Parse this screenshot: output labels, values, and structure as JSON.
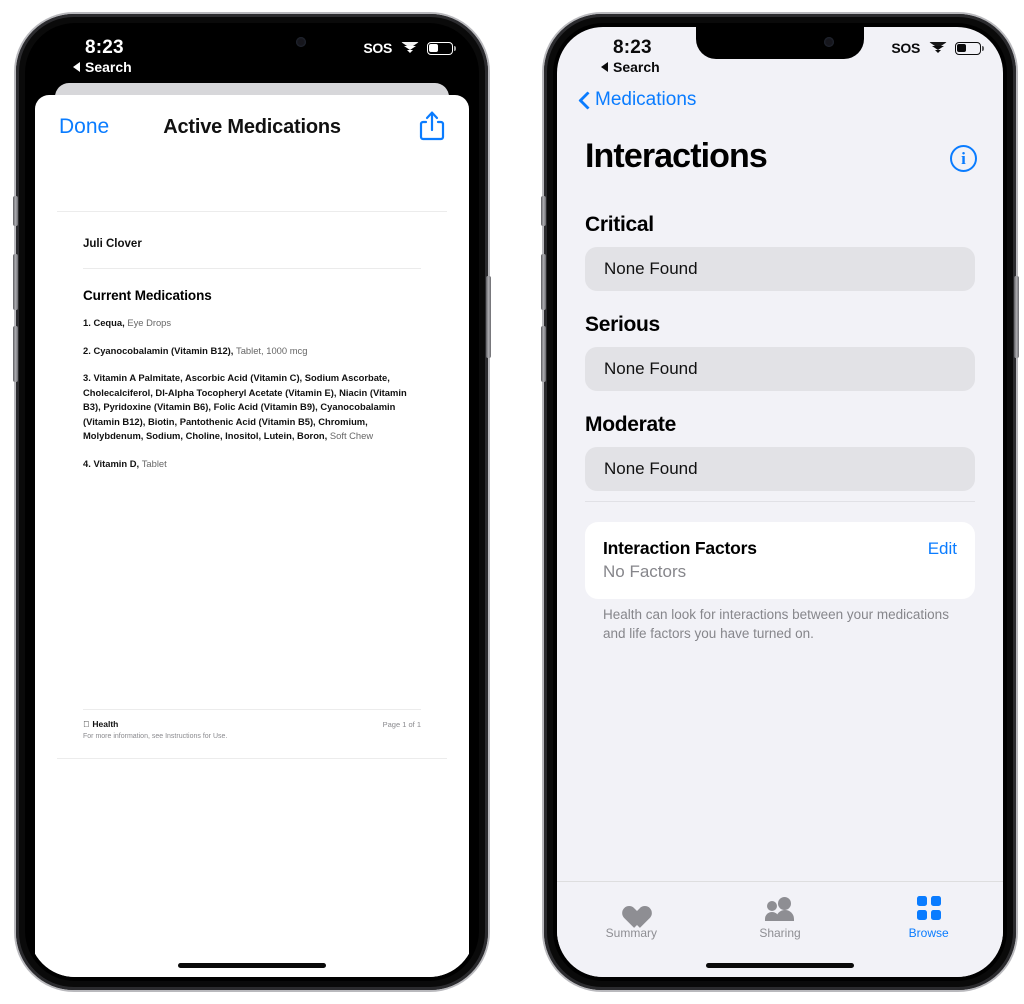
{
  "left_phone": {
    "status_bar": {
      "time": "8:23",
      "sos": "SOS",
      "back_label": "Search"
    },
    "sheet": {
      "done_label": "Done",
      "title": "Active Medications",
      "share_icon": "share-icon"
    },
    "document": {
      "patient_name": "Juli Clover",
      "section_heading": "Current Medications",
      "medications": [
        {
          "index": "1.",
          "name": "Cequa,",
          "form": "Eye Drops"
        },
        {
          "index": "2.",
          "name": "Cyanocobalamin (Vitamin B12),",
          "form": "Tablet, 1000 mcg"
        },
        {
          "index": "3.",
          "name": "Vitamin A Palmitate, Ascorbic Acid (Vitamin C), Sodium Ascorbate, Cholecalciferol, Dl-Alpha Tocopheryl Acetate (Vitamin E), Niacin (Vitamin B3), Pyridoxine (Vitamin B6), Folic Acid (Vitamin B9), Cyanocobalamin (Vitamin B12), Biotin, Pantothenic Acid (Vitamin B5), Chromium, Molybdenum, Sodium, Choline, Inositol, Lutein, Boron,",
          "form": "Soft Chew"
        },
        {
          "index": "4.",
          "name": "Vitamin D,",
          "form": "Tablet"
        }
      ],
      "footer": {
        "brand": "Health",
        "note": "For more information, see Instructions for Use.",
        "page": "Page 1 of 1"
      }
    }
  },
  "right_phone": {
    "status_bar": {
      "time": "8:23",
      "sos": "SOS",
      "back_label": "Search"
    },
    "nav": {
      "back_label": "Medications",
      "info_icon": "info-icon",
      "info_glyph": "i"
    },
    "page_title": "Interactions",
    "sections": [
      {
        "heading": "Critical",
        "value": "None Found"
      },
      {
        "heading": "Serious",
        "value": "None Found"
      },
      {
        "heading": "Moderate",
        "value": "None Found"
      }
    ],
    "interaction_factors": {
      "title": "Interaction Factors",
      "edit_label": "Edit",
      "subtitle": "No Factors",
      "note": "Health can look for interactions between your medications and life factors you have turned on."
    },
    "tabs": [
      {
        "label": "Summary",
        "icon": "heart-icon",
        "active": false
      },
      {
        "label": "Sharing",
        "icon": "people-icon",
        "active": false
      },
      {
        "label": "Browse",
        "icon": "grid-icon",
        "active": true
      }
    ]
  },
  "colors": {
    "accent": "#0a7cff",
    "pill_bg": "#e2e2e6",
    "page_bg": "#f2f2f7",
    "muted": "#86868b"
  }
}
